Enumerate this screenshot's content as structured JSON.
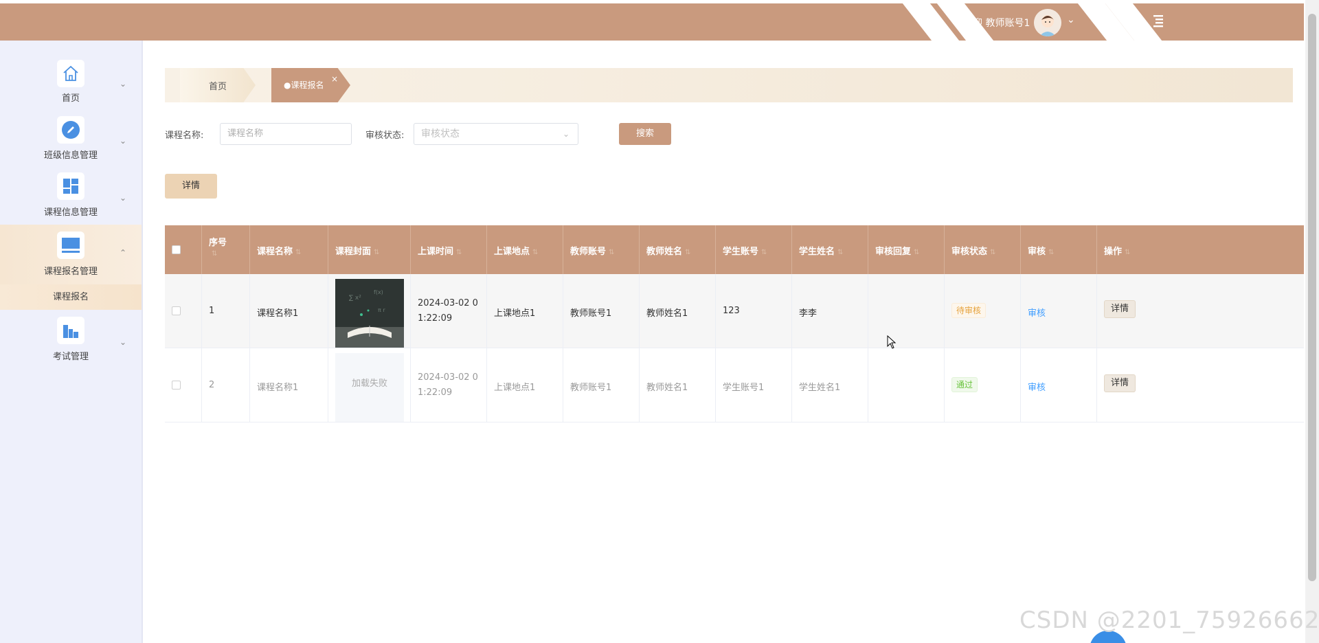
{
  "header": {
    "welcome": "欢迎 教师账号1",
    "brand_color": "#c99a7e"
  },
  "sidebar": {
    "items": [
      {
        "label": "首页",
        "icon": "home-icon"
      },
      {
        "label": "班级信息管理",
        "icon": "pencil-icon"
      },
      {
        "label": "课程信息管理",
        "icon": "grid-icon"
      },
      {
        "label": "课程报名管理",
        "icon": "monitor-icon",
        "active": true,
        "sub": "课程报名"
      },
      {
        "label": "考试管理",
        "icon": "building-icon"
      }
    ]
  },
  "tabs": {
    "home": "首页",
    "current": "●课程报名",
    "close": "×"
  },
  "search": {
    "course_label": "课程名称:",
    "course_placeholder": "课程名称",
    "status_label": "审核状态:",
    "status_placeholder": "审核状态",
    "button": "搜索"
  },
  "toolbar": {
    "detail": "详情"
  },
  "table": {
    "columns": [
      "序号",
      "课程名称",
      "课程封面",
      "上课时间",
      "上课地点",
      "教师账号",
      "教师姓名",
      "学生账号",
      "学生姓名",
      "审核回复",
      "审核状态",
      "审核",
      "操作"
    ],
    "rows": [
      {
        "index": "1",
        "course": "课程名称1",
        "cover": "",
        "time": "2024-03-02 01:22:09",
        "time_l1": "2024-03-02 0",
        "time_l2": "1:22:09",
        "place": "上课地点1",
        "teacher_account": "教师账号1",
        "teacher_name": "教师姓名1",
        "student_account": "123",
        "student_name": "李李",
        "reply": "",
        "status": "待审核",
        "review": "审核",
        "op": "详情"
      },
      {
        "index": "2",
        "course": "课程名称1",
        "cover": "加载失败",
        "time": "2024-03-02 01:22:09",
        "time_l1": "2024-03-02 0",
        "time_l2": "1:22:09",
        "place": "上课地点1",
        "teacher_account": "教师账号1",
        "teacher_name": "教师姓名1",
        "student_account": "学生账号1",
        "student_name": "学生姓名1",
        "reply": "",
        "status": "通过",
        "review": "审核",
        "op": "详情"
      }
    ]
  },
  "watermark": "CSDN @2201_75926662"
}
